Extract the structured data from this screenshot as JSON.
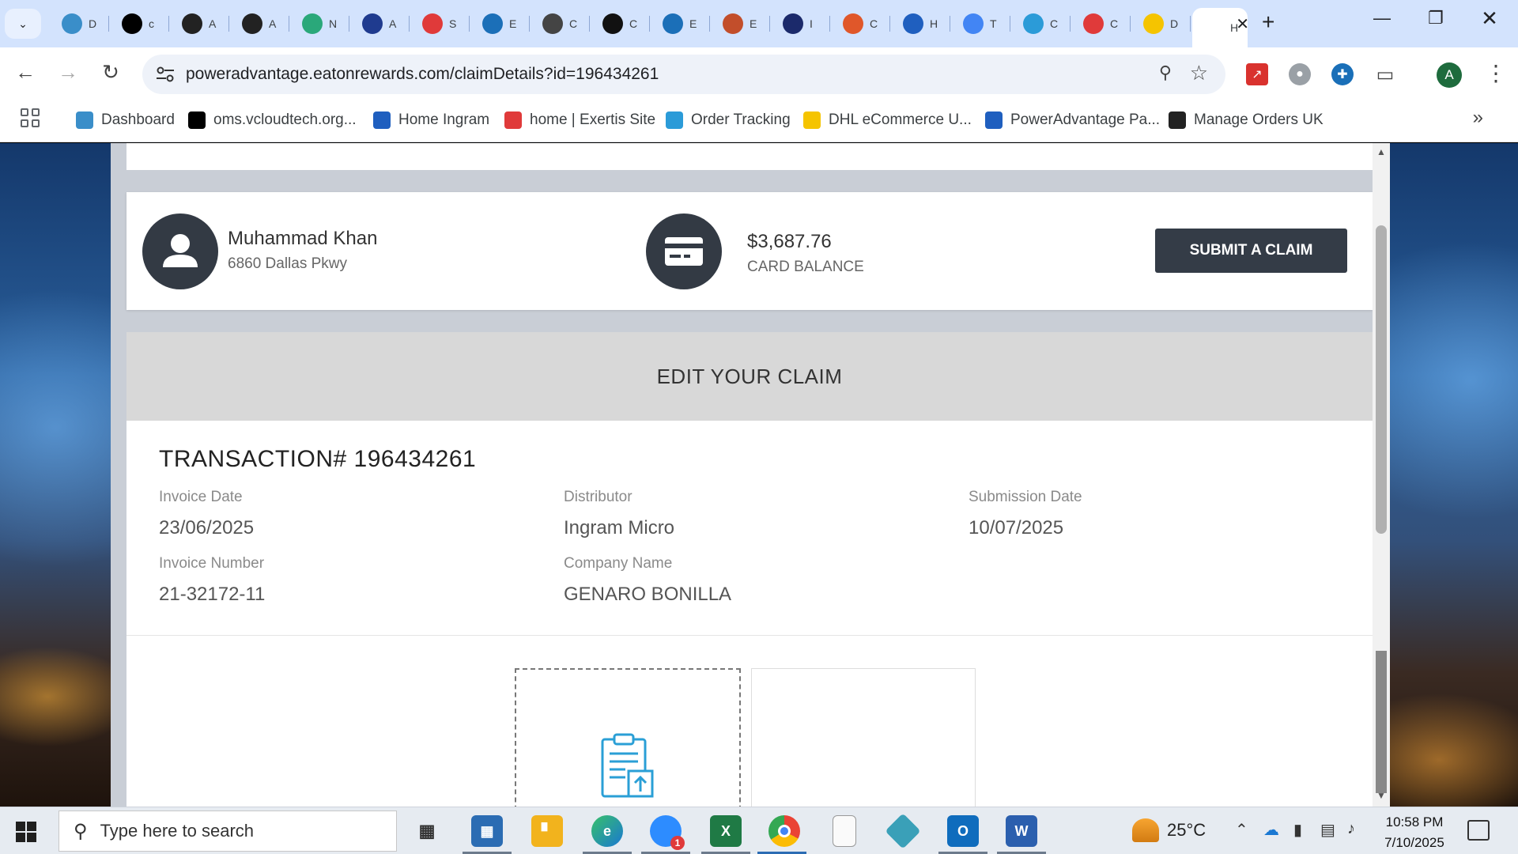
{
  "browser": {
    "tabs": [
      {
        "letter": "D",
        "icon": "hexagon-icon",
        "color": "#3a8ec9"
      },
      {
        "letter": "c",
        "icon": "triangle-logo-icon",
        "color": "#000000"
      },
      {
        "letter": "A",
        "icon": "amazon-icon",
        "color": "#222222"
      },
      {
        "letter": "A",
        "icon": "amazon-icon",
        "color": "#222222"
      },
      {
        "letter": "N",
        "icon": "leaf-icon",
        "color": "#2aa87a"
      },
      {
        "letter": "A",
        "icon": "arrow-icon",
        "color": "#1f3b8f"
      },
      {
        "letter": "S",
        "icon": "exertis-icon",
        "color": "#e03a3a"
      },
      {
        "letter": "E",
        "icon": "e-logo-icon",
        "color": "#1b6fb8"
      },
      {
        "letter": "C",
        "icon": "openai-icon",
        "color": "#444444"
      },
      {
        "letter": "C",
        "icon": "openai-icon",
        "color": "#111111"
      },
      {
        "letter": "E",
        "icon": "e-logo-icon",
        "color": "#1b6fb8"
      },
      {
        "letter": "E",
        "icon": "bulb-icon",
        "color": "#c24e2b"
      },
      {
        "letter": "I",
        "icon": "bu-logo-icon",
        "color": "#1b2a6b"
      },
      {
        "letter": "C",
        "icon": "stack-icon",
        "color": "#e0572a"
      },
      {
        "letter": "H",
        "icon": "ingram-icon",
        "color": "#1f5fbf"
      },
      {
        "letter": "T",
        "icon": "google-icon",
        "color": "#4285f4"
      },
      {
        "letter": "C",
        "icon": "tracking-icon",
        "color": "#2b9bd8"
      },
      {
        "letter": "C",
        "icon": "exertis-icon",
        "color": "#e03a3a"
      },
      {
        "letter": "D",
        "icon": "dhl-icon",
        "color": "#f5c400"
      },
      {
        "letter": "H",
        "icon": "page-icon",
        "color": "#ffffff"
      }
    ],
    "url": "poweradvantage.eatonrewards.com/claimDetails?id=196434261",
    "avatar_letter": "A",
    "bookmarks": [
      {
        "label": "Dashboard",
        "icon": "hexagon-icon",
        "color": "#3a8ec9"
      },
      {
        "label": "oms.vcloudtech.org...",
        "icon": "triangle-logo-icon",
        "color": "#000000"
      },
      {
        "label": "Home Ingram",
        "icon": "ingram-icon",
        "color": "#1f5fbf"
      },
      {
        "label": "home | Exertis Site",
        "icon": "exertis-icon",
        "color": "#e03a3a"
      },
      {
        "label": "Order Tracking",
        "icon": "tracking-icon",
        "color": "#2b9bd8"
      },
      {
        "label": "DHL eCommerce U...",
        "icon": "dhl-icon",
        "color": "#f5c400"
      },
      {
        "label": "PowerAdvantage Pa...",
        "icon": "doc-icon",
        "color": "#1f5fbf"
      },
      {
        "label": "Manage Orders UK",
        "icon": "amazon-icon",
        "color": "#222222"
      }
    ]
  },
  "page": {
    "user": {
      "name": "Muhammad Khan",
      "address": "6860 Dallas Pkwy"
    },
    "balance": {
      "amount": "$3,687.76",
      "label": "CARD BALANCE"
    },
    "submit_label": "SUBMIT A CLAIM",
    "claim": {
      "heading": "EDIT YOUR CLAIM",
      "transaction": "TRANSACTION# 196434261",
      "invoice_date_label": "Invoice Date",
      "invoice_date": "23/06/2025",
      "distributor_label": "Distributor",
      "distributor": "Ingram Micro",
      "submission_date_label": "Submission Date",
      "submission_date": "10/07/2025",
      "invoice_number_label": "Invoice Number",
      "invoice_number": "21-32172-11",
      "company_name_label": "Company Name",
      "company_name": "GENARO BONILLA"
    }
  },
  "taskbar": {
    "search_placeholder": "Type here to search",
    "temperature": "25°C",
    "time": "10:58 PM",
    "date": "7/10/2025",
    "zoom_badge": "1"
  },
  "colors": {
    "accent_dark": "#343c47",
    "upload_icon": "#2a9fd6",
    "tab_strip": "#d3e3fd"
  }
}
